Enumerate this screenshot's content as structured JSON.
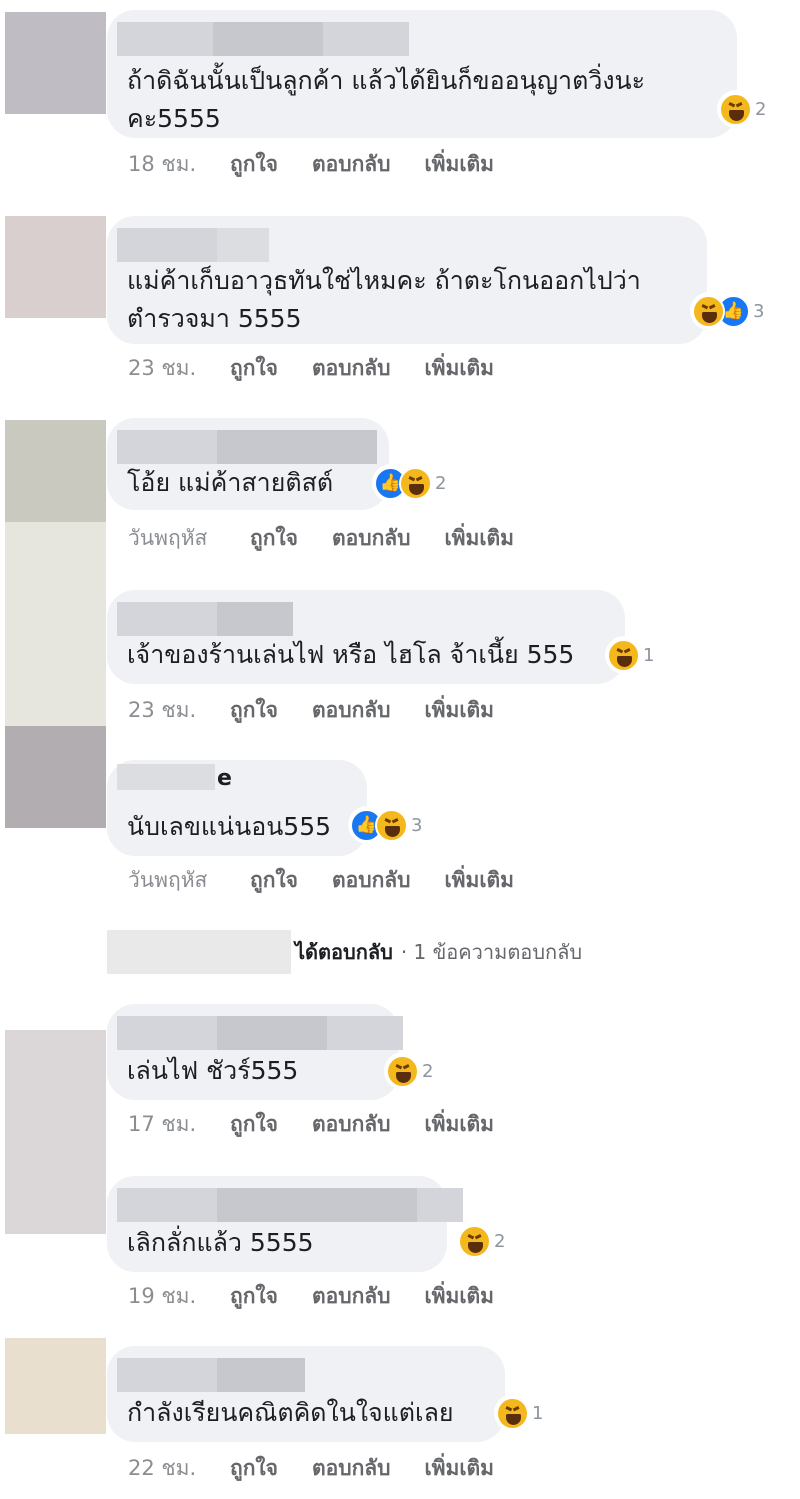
{
  "comments": [
    {
      "text": "ถ้าดิฉันนั้นเป็นลูกค้า แล้วได้ยินก็ขออนุญาตวิ่งนะ\nคะ5555",
      "reactions": [
        "haha"
      ],
      "count": "2",
      "time": "18 ชม.",
      "avatar_color": "#bfbcc4"
    },
    {
      "text": "แม่ค้าเก็บอาวุธทันใช่ไหมคะ ถ้าตะโกนออกไปว่า\nตำรวจมา 5555",
      "reactions": [
        "haha",
        "like"
      ],
      "count": "3",
      "time": "23 ชม.",
      "avatar_color": "#d8cfce"
    },
    {
      "text": "โอ้ย แม่ค้าสายติสต์",
      "reactions": [
        "like",
        "haha"
      ],
      "count": "2",
      "time": "วันพฤหัส",
      "avatar_color": "#c9c9c0"
    },
    {
      "text": "เจ้าของร้านเล่นไฟ หรือ ไฮโล จ้าเนี้ย 555",
      "reactions": [
        "haha"
      ],
      "count": "1",
      "time": "23 ชม.",
      "avatar_color": "#e6e6df"
    },
    {
      "name_fragment": "e",
      "text": "นับเลขแน่นอน555",
      "reactions": [
        "like",
        "haha"
      ],
      "count": "3",
      "time": "วันพฤหัส",
      "avatar_color": "#b1adb0"
    },
    {
      "text": "เล่นไฟ ชัวร์555",
      "reactions": [
        "haha"
      ],
      "count": "2",
      "time": "17 ชม.",
      "avatar_color": "#dbd6d8"
    },
    {
      "text": "เลิกลั่กแล้ว 5555",
      "reactions": [
        "haha"
      ],
      "count": "2",
      "time": "19 ชม.",
      "avatar_color": "#d6d0d4"
    },
    {
      "text": "กำลังเรียนคณิตคิดในใจแต่เลย",
      "reactions": [
        "haha"
      ],
      "count": "1",
      "time": "22 ชม.",
      "avatar_color": "#e8dfcf"
    }
  ],
  "actions": {
    "like": "ถูกใจ",
    "reply": "ตอบกลับ",
    "more": "เพิ่มเติม"
  },
  "replies": {
    "label": "ได้ตอบกลับ",
    "count": "· 1 ข้อความตอบกลับ"
  },
  "icons": {
    "haha": "haha-reaction-icon",
    "like": "like-reaction-icon"
  },
  "colors": {
    "bubble": "#eff1f4",
    "like": "#1877f2",
    "haha": "#f5b81c",
    "meta": "#65676b"
  }
}
